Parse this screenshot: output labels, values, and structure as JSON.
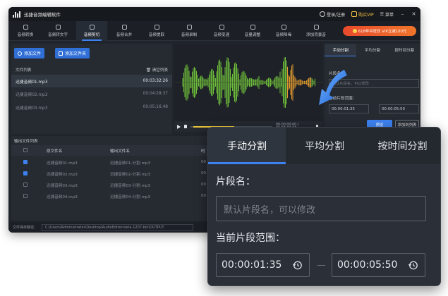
{
  "app": {
    "title": "迅捷音频编辑软件",
    "login": "登录/注册",
    "buy_vip": "购买VIP",
    "menu": "菜单"
  },
  "toolbar": {
    "items": [
      {
        "label": "音频转换",
        "icon": "refresh-icon"
      },
      {
        "label": "音频转文字",
        "icon": "text-icon"
      },
      {
        "label": "音频剪切",
        "icon": "scissors-icon"
      },
      {
        "label": "音频合并",
        "icon": "merge-icon"
      },
      {
        "label": "音频提取",
        "icon": "extract-icon"
      },
      {
        "label": "音频录制",
        "icon": "mic-icon"
      },
      {
        "label": "音频变速",
        "icon": "speed-icon"
      },
      {
        "label": "音量调整",
        "icon": "volume-icon"
      },
      {
        "label": "音频降噪",
        "icon": "noise-icon"
      },
      {
        "label": "添加背景音",
        "icon": "music-icon"
      }
    ],
    "active_index": 2,
    "promo": "618年中狂欢 VIP立减100元"
  },
  "left_panel": {
    "add_file": "添加文件",
    "add_folder": "添加文件夹",
    "list_title": "文件列表",
    "clear_list": "清空列表",
    "files": [
      {
        "name": "迅捷音频01.mp3",
        "duration": "00:03:32:26",
        "selected": true
      },
      {
        "name": "迅捷音频02.mp3",
        "duration": "00:04:28:37",
        "selected": false
      },
      {
        "name": "迅捷音频03.mp3",
        "duration": "00:05:16:48",
        "selected": false
      }
    ]
  },
  "player": {
    "time": "00:00:00:00 / 00:03:32:26"
  },
  "right_panel": {
    "tabs": [
      "手动分割",
      "平均分割",
      "按时间分割"
    ],
    "segment_label": "片段名：",
    "segment_placeholder": "默认片段名，可以修改",
    "range_label": "当前片段范围：",
    "start": "00:00:01:35",
    "end": "00:00:05:50",
    "preview": "预览",
    "add_to_list": "添加到列表"
  },
  "output": {
    "title": "输出文件列表",
    "columns": [
      "原文件名",
      "输出文件名",
      "时"
    ],
    "rows": [
      {
        "src": "迅捷音频01.mp3",
        "out": "迅捷音频01-分割.mp3",
        "t": "00",
        "checked": true
      },
      {
        "src": "迅捷音频02.mp3",
        "out": "迅捷音频02-分割.mp3",
        "t": "00",
        "checked": true
      },
      {
        "src": "迅捷音频03.mp3",
        "out": "迅捷音频03-分割.mp3",
        "t": "00",
        "checked": false
      },
      {
        "src": "迅捷音频04.mp3",
        "out": "迅捷音频04-分割.mp3",
        "t": "00",
        "checked": false
      }
    ],
    "save_label": "文件保存路径：",
    "save_path": "C:\\Users\\Administrator\\Desktop\\AudioEditor-beta-1207-bin\\OUTPUT"
  },
  "zoom": {
    "tabs": [
      "手动分割",
      "平均分割",
      "按时间分割"
    ],
    "segment_label": "片段名：",
    "segment_placeholder": "默认片段名，可以修改",
    "range_label": "当前片段范围：",
    "start": "00:00:01:35",
    "end": "00:00:05:50"
  },
  "colors": {
    "accent": "#3d82f0",
    "wave_green": "#6fbf3a",
    "wave_orange": "#e39a2e",
    "promo": "#e84a2c",
    "vip": "#f6c342"
  }
}
